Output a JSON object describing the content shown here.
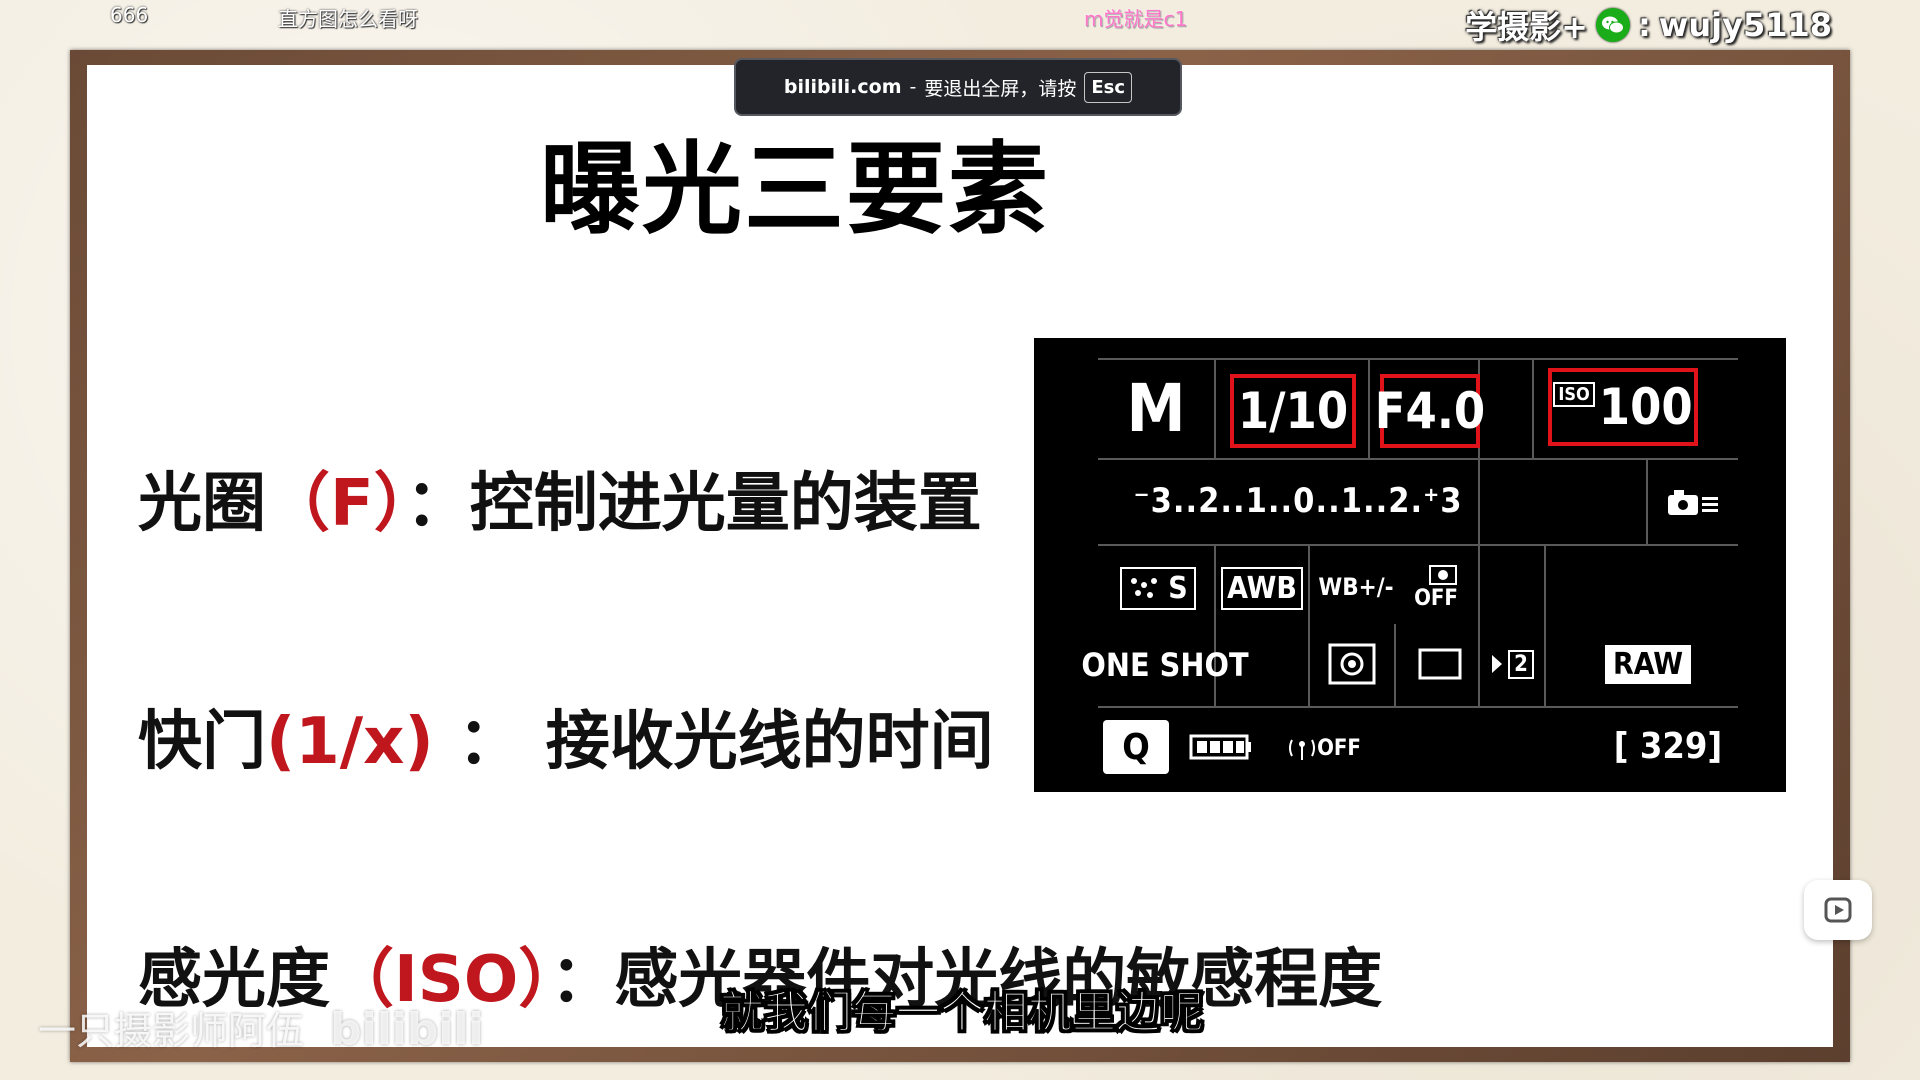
{
  "danmaku": {
    "left": "666",
    "center": "直方图怎么看呀",
    "pink": "m觉就是c1"
  },
  "channel": {
    "prefix": "学摄影+",
    "separator": ":",
    "handle": "wujy5118"
  },
  "toast": {
    "site": "bilibili.com",
    "dash": "-",
    "message": "要退出全屏，请按",
    "key": "Esc"
  },
  "slide": {
    "title": "曝光三要素",
    "lines": [
      {
        "term": "光圈",
        "symbol": "（F）",
        "colon": "：",
        "desc": "控制进光量的装置"
      },
      {
        "term": "快门",
        "symbol": "(1/x)",
        "colon": "：",
        "desc": "接收光线的时间"
      },
      {
        "term": "感光度",
        "symbol": "（ISO）",
        "colon": "：",
        "desc": "感光器件对光线的敏感程度"
      }
    ]
  },
  "lcd": {
    "mode": "M",
    "shutter": "1/10",
    "aperture": "F4.0",
    "iso_label": "ISO",
    "iso_value": "100",
    "exposure_scale": "⁻3..2..1..0..1..2.⁺3",
    "picture_style": "S",
    "white_balance": "AWB",
    "wb_shift": "WB+/-",
    "alo": "OFF",
    "af_mode": "ONE SHOT",
    "drive_index": "2",
    "quality": "RAW",
    "q_button": "Q",
    "wifi": "OFF",
    "shots_remaining": "[ 329]"
  },
  "subtitle": "就我们每一个相机里边呢",
  "watermark": {
    "text": "一只摄影师阿伍",
    "logo": "bilibili"
  }
}
